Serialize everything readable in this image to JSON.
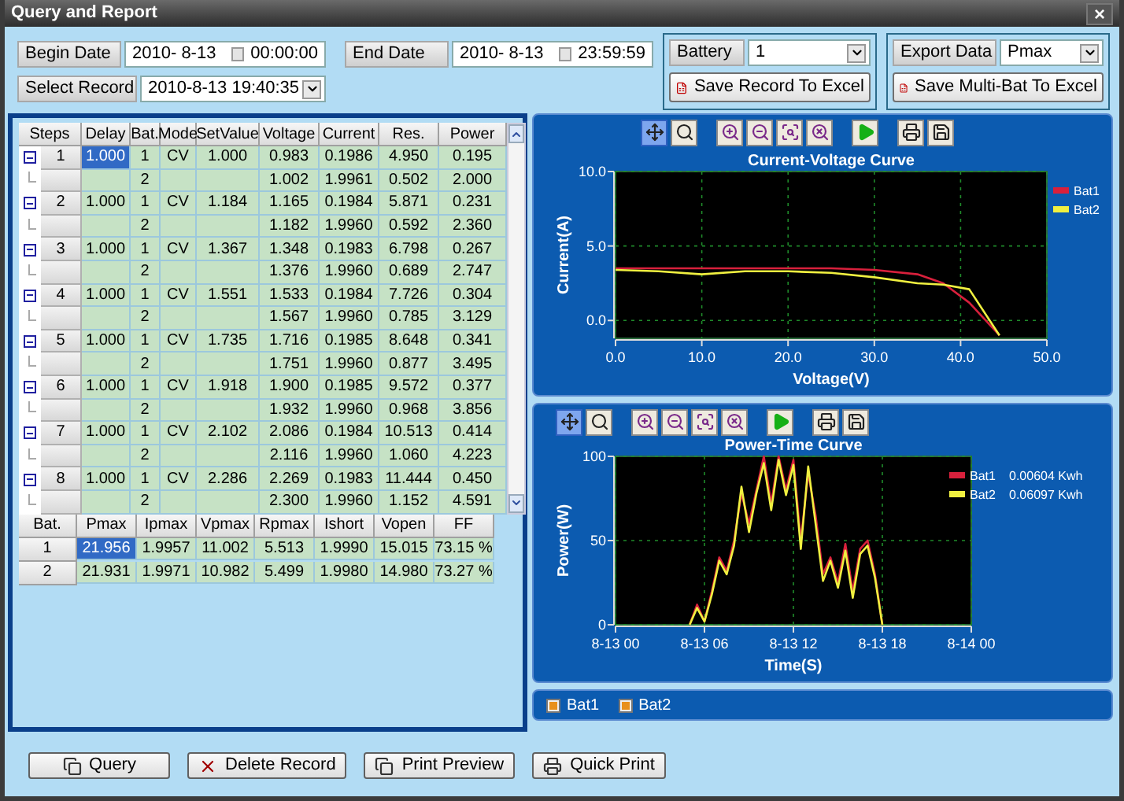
{
  "window": {
    "title": "Query and Report",
    "close": "×"
  },
  "filters": {
    "begin_label": "Begin Date",
    "begin_date": "2010- 8-13",
    "begin_time": "00:00:00",
    "end_label": "End Date",
    "end_date": "2010- 8-13",
    "end_time": "23:59:59",
    "record_label": "Select Record",
    "record": "2010-8-13 19:40:35"
  },
  "battery": {
    "label": "Battery",
    "value": "1",
    "button": "Save Record To Excel"
  },
  "export": {
    "label": "Export Data",
    "value": "Pmax",
    "button": "Save Multi-Bat To Excel"
  },
  "steps_table": {
    "columns": [
      "Steps",
      "Delay",
      "Bat.",
      "Mode",
      "SetValue",
      "Voltage",
      "Current",
      "Res.",
      "Power"
    ],
    "steps": [
      {
        "step": "1",
        "expanded": true,
        "delay": {
          "text": "1.000",
          "selected": true
        },
        "mode": "CV",
        "setvalue": "1.000",
        "bats": [
          {
            "bat": "1",
            "voltage": "0.983",
            "current": "0.1986",
            "res": "4.950",
            "power": "0.195"
          },
          {
            "bat": "2",
            "voltage": "1.002",
            "current": "1.9961",
            "res": "0.502",
            "power": "2.000"
          }
        ]
      },
      {
        "step": "2",
        "expanded": true,
        "delay": {
          "text": "1.000",
          "selected": false
        },
        "mode": "CV",
        "setvalue": "1.184",
        "bats": [
          {
            "bat": "1",
            "voltage": "1.165",
            "current": "0.1984",
            "res": "5.871",
            "power": "0.231"
          },
          {
            "bat": "2",
            "voltage": "1.182",
            "current": "1.9960",
            "res": "0.592",
            "power": "2.360"
          }
        ]
      },
      {
        "step": "3",
        "expanded": true,
        "delay": {
          "text": "1.000",
          "selected": false
        },
        "mode": "CV",
        "setvalue": "1.367",
        "bats": [
          {
            "bat": "1",
            "voltage": "1.348",
            "current": "0.1983",
            "res": "6.798",
            "power": "0.267"
          },
          {
            "bat": "2",
            "voltage": "1.376",
            "current": "1.9960",
            "res": "0.689",
            "power": "2.747"
          }
        ]
      },
      {
        "step": "4",
        "expanded": true,
        "delay": {
          "text": "1.000",
          "selected": false
        },
        "mode": "CV",
        "setvalue": "1.551",
        "bats": [
          {
            "bat": "1",
            "voltage": "1.533",
            "current": "0.1984",
            "res": "7.726",
            "power": "0.304"
          },
          {
            "bat": "2",
            "voltage": "1.567",
            "current": "1.9960",
            "res": "0.785",
            "power": "3.129"
          }
        ]
      },
      {
        "step": "5",
        "expanded": true,
        "delay": {
          "text": "1.000",
          "selected": false
        },
        "mode": "CV",
        "setvalue": "1.735",
        "bats": [
          {
            "bat": "1",
            "voltage": "1.716",
            "current": "0.1985",
            "res": "8.648",
            "power": "0.341"
          },
          {
            "bat": "2",
            "voltage": "1.751",
            "current": "1.9960",
            "res": "0.877",
            "power": "3.495"
          }
        ]
      },
      {
        "step": "6",
        "expanded": true,
        "delay": {
          "text": "1.000",
          "selected": false
        },
        "mode": "CV",
        "setvalue": "1.918",
        "bats": [
          {
            "bat": "1",
            "voltage": "1.900",
            "current": "0.1985",
            "res": "9.572",
            "power": "0.377"
          },
          {
            "bat": "2",
            "voltage": "1.932",
            "current": "1.9960",
            "res": "0.968",
            "power": "3.856"
          }
        ]
      },
      {
        "step": "7",
        "expanded": true,
        "delay": {
          "text": "1.000",
          "selected": false
        },
        "mode": "CV",
        "setvalue": "2.102",
        "bats": [
          {
            "bat": "1",
            "voltage": "2.086",
            "current": "0.1984",
            "res": "10.513",
            "power": "0.414"
          },
          {
            "bat": "2",
            "voltage": "2.116",
            "current": "1.9960",
            "res": "1.060",
            "power": "4.223"
          }
        ]
      },
      {
        "step": "8",
        "expanded": true,
        "delay": {
          "text": "1.000",
          "selected": false
        },
        "mode": "CV",
        "setvalue": "2.286",
        "bats": [
          {
            "bat": "1",
            "voltage": "2.269",
            "current": "0.1983",
            "res": "11.444",
            "power": "0.450"
          },
          {
            "bat": "2",
            "voltage": "2.300",
            "current": "1.9960",
            "res": "1.152",
            "power": "4.591"
          }
        ]
      }
    ]
  },
  "summary_table": {
    "columns": [
      "Bat.",
      "Pmax",
      "Ipmax",
      "Vpmax",
      "Rpmax",
      "Ishort",
      "Vopen",
      "FF"
    ],
    "rows": [
      {
        "bat": "1",
        "pmax": {
          "text": "21.956",
          "selected": true
        },
        "values": [
          "1.9957",
          "11.002",
          "5.513",
          "1.9990",
          "15.015",
          "73.15 %"
        ]
      },
      {
        "bat": "2",
        "pmax": {
          "text": "21.931",
          "selected": false
        },
        "values": [
          "1.9971",
          "10.982",
          "5.499",
          "1.9980",
          "14.980",
          "73.27 %"
        ]
      }
    ]
  },
  "iv_panel": {
    "toolbar": [
      {
        "kind": "pan",
        "selected": true
      },
      {
        "kind": "zoom-fit",
        "selected": false
      },
      {
        "kind": "zoom-in",
        "selected": false
      },
      {
        "kind": "zoom-out",
        "selected": false
      },
      {
        "kind": "zoom-box",
        "selected": false
      },
      {
        "kind": "zoom-reset",
        "selected": false
      },
      {
        "kind": "play",
        "selected": false
      },
      {
        "kind": "print",
        "selected": false
      },
      {
        "kind": "save",
        "selected": false
      }
    ],
    "chart_data": {
      "type": "line",
      "title": "Current-Voltage Curve",
      "xlabel": "Voltage(V)",
      "ylabel": "Current(A)",
      "grid": true,
      "legend": true,
      "xlim": [
        0,
        50
      ],
      "ylim": [
        -1.2,
        10
      ],
      "xticks": [
        {
          "value": 0,
          "label": "0.0"
        },
        {
          "value": 10,
          "label": "10.0"
        },
        {
          "value": 20,
          "label": "20.0"
        },
        {
          "value": 30,
          "label": "30.0"
        },
        {
          "value": 40,
          "label": "40.0"
        },
        {
          "value": 50,
          "label": "50.0"
        }
      ],
      "yticks": [
        {
          "value": 0,
          "label": "0.0"
        },
        {
          "value": 5,
          "label": "5.0"
        },
        {
          "value": 10,
          "label": "10.0"
        }
      ],
      "x": [
        0,
        5,
        10,
        15,
        20,
        25,
        30,
        35,
        38,
        41,
        44.5
      ],
      "series": [
        {
          "name": "Bat1",
          "color": "#d8203c",
          "values": [
            3.5,
            3.5,
            3.5,
            3.5,
            3.5,
            3.5,
            3.4,
            3.1,
            2.5,
            1.2,
            -1
          ]
        },
        {
          "name": "Bat2",
          "color": "#f0f040",
          "values": [
            3.4,
            3.3,
            3.1,
            3.3,
            3.3,
            3.2,
            2.9,
            2.5,
            2.4,
            2.1,
            -1
          ]
        }
      ]
    }
  },
  "pt_panel": {
    "toolbar": [
      {
        "kind": "pan",
        "selected": true
      },
      {
        "kind": "zoom-fit",
        "selected": false
      },
      {
        "kind": "zoom-in",
        "selected": false
      },
      {
        "kind": "zoom-out",
        "selected": false
      },
      {
        "kind": "zoom-box",
        "selected": false
      },
      {
        "kind": "zoom-reset",
        "selected": false
      },
      {
        "kind": "play",
        "selected": false
      },
      {
        "kind": "print",
        "selected": false
      },
      {
        "kind": "save",
        "selected": false
      }
    ],
    "energies": [
      "0.00604 Kwh",
      "0.06097 Kwh"
    ],
    "chart_data": {
      "type": "line",
      "title": "Power-Time Curve",
      "xlabel": "Time(S)",
      "ylabel": "Power(W)",
      "grid": true,
      "legend": true,
      "ylim": [
        0,
        100
      ],
      "categories": [
        "8-13 00",
        null,
        null,
        null,
        null,
        null,
        null,
        null,
        null,
        null,
        null,
        null,
        "8-13 06",
        null,
        null,
        null,
        null,
        null,
        null,
        null,
        null,
        null,
        null,
        null,
        "8-13 12",
        null,
        null,
        null,
        null,
        null,
        null,
        null,
        null,
        null,
        null,
        null,
        "8-13 18",
        null,
        null,
        null,
        null,
        null,
        null,
        null,
        null,
        null,
        null,
        null,
        "8-14 00"
      ],
      "yticks": [
        0,
        50,
        100
      ],
      "series": [
        {
          "name": "Bat1",
          "color": "#d8203c",
          "values": [
            null,
            null,
            null,
            null,
            null,
            null,
            null,
            null,
            null,
            null,
            0,
            12,
            2,
            20,
            40,
            32,
            50,
            78,
            60,
            80,
            100,
            72,
            100,
            80,
            98,
            50,
            90,
            65,
            30,
            40,
            25,
            48,
            20,
            45,
            50,
            30,
            0,
            null,
            null,
            null,
            null,
            null,
            null,
            null,
            null,
            null,
            null,
            null,
            null
          ]
        },
        {
          "name": "Bat2",
          "color": "#f0f040",
          "values": [
            null,
            null,
            null,
            null,
            null,
            null,
            null,
            null,
            null,
            null,
            0,
            10,
            2,
            18,
            38,
            30,
            47,
            82,
            55,
            78,
            96,
            68,
            98,
            77,
            95,
            45,
            94,
            60,
            26,
            38,
            22,
            44,
            16,
            42,
            47,
            28,
            0,
            null,
            null,
            null,
            null,
            null,
            null,
            null,
            null,
            null,
            null,
            null,
            null
          ]
        }
      ]
    }
  },
  "legend_strip": [
    {
      "label": "Bat1",
      "checked": true
    },
    {
      "label": "Bat2",
      "checked": true
    }
  ],
  "buttons": [
    {
      "kind": "query",
      "label": "Query"
    },
    {
      "kind": "delete",
      "label": "Delete Record"
    },
    {
      "kind": "preview",
      "label": "Print Preview"
    },
    {
      "kind": "print",
      "label": "Quick Print"
    }
  ]
}
